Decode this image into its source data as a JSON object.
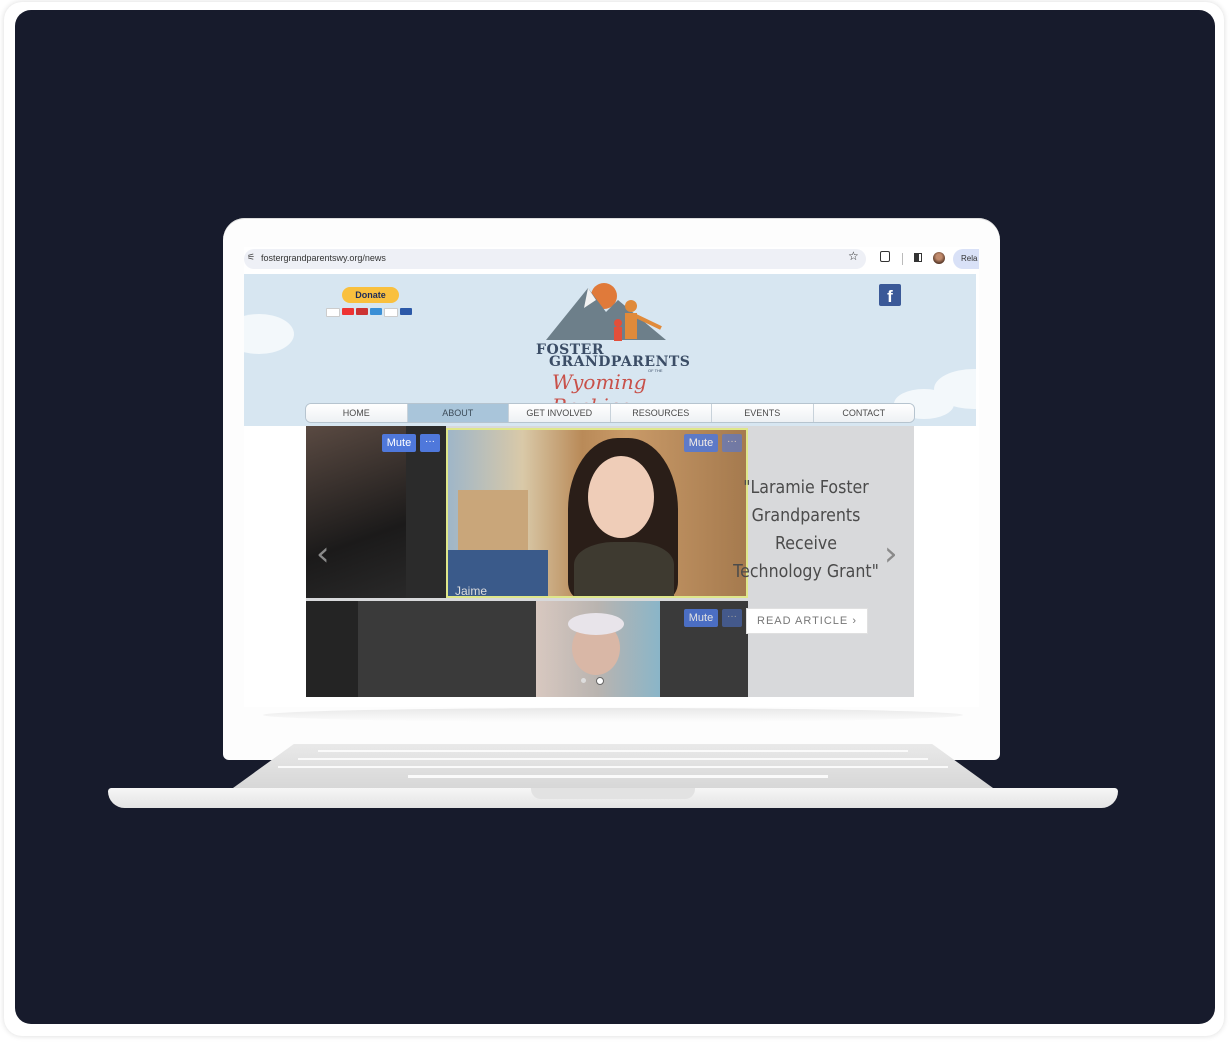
{
  "browser": {
    "url": "fostergrandparentswy.org/news",
    "relaunch_label": "Rela"
  },
  "site": {
    "donate_label": "Donate",
    "logo": {
      "line1": "FOSTER",
      "line2": "GRANDPARENTS",
      "small": "OF THE",
      "script": "Wyoming Rockies"
    },
    "nav": [
      "HOME",
      "ABOUT",
      "GET INVOLVED",
      "RESOURCES",
      "EVENTS",
      "CONTACT"
    ],
    "active_nav": "ABOUT"
  },
  "slideshow": {
    "mute_label": "Mute",
    "more_label": "···",
    "participant_name": "Jaime",
    "quote": "\"Laramie Foster Grandparents Receive Technology Grant\"",
    "read_button": "READ ARTICLE ›",
    "prev_arrow": "‹",
    "next_arrow": "›"
  },
  "colors": {
    "background": "#171b2c",
    "header_sky": "#d7e6f1",
    "nav_active": "#a9c5da",
    "zoom_blue": "#4f78db",
    "donate": "#f9c03e",
    "facebook": "#3b5998"
  }
}
